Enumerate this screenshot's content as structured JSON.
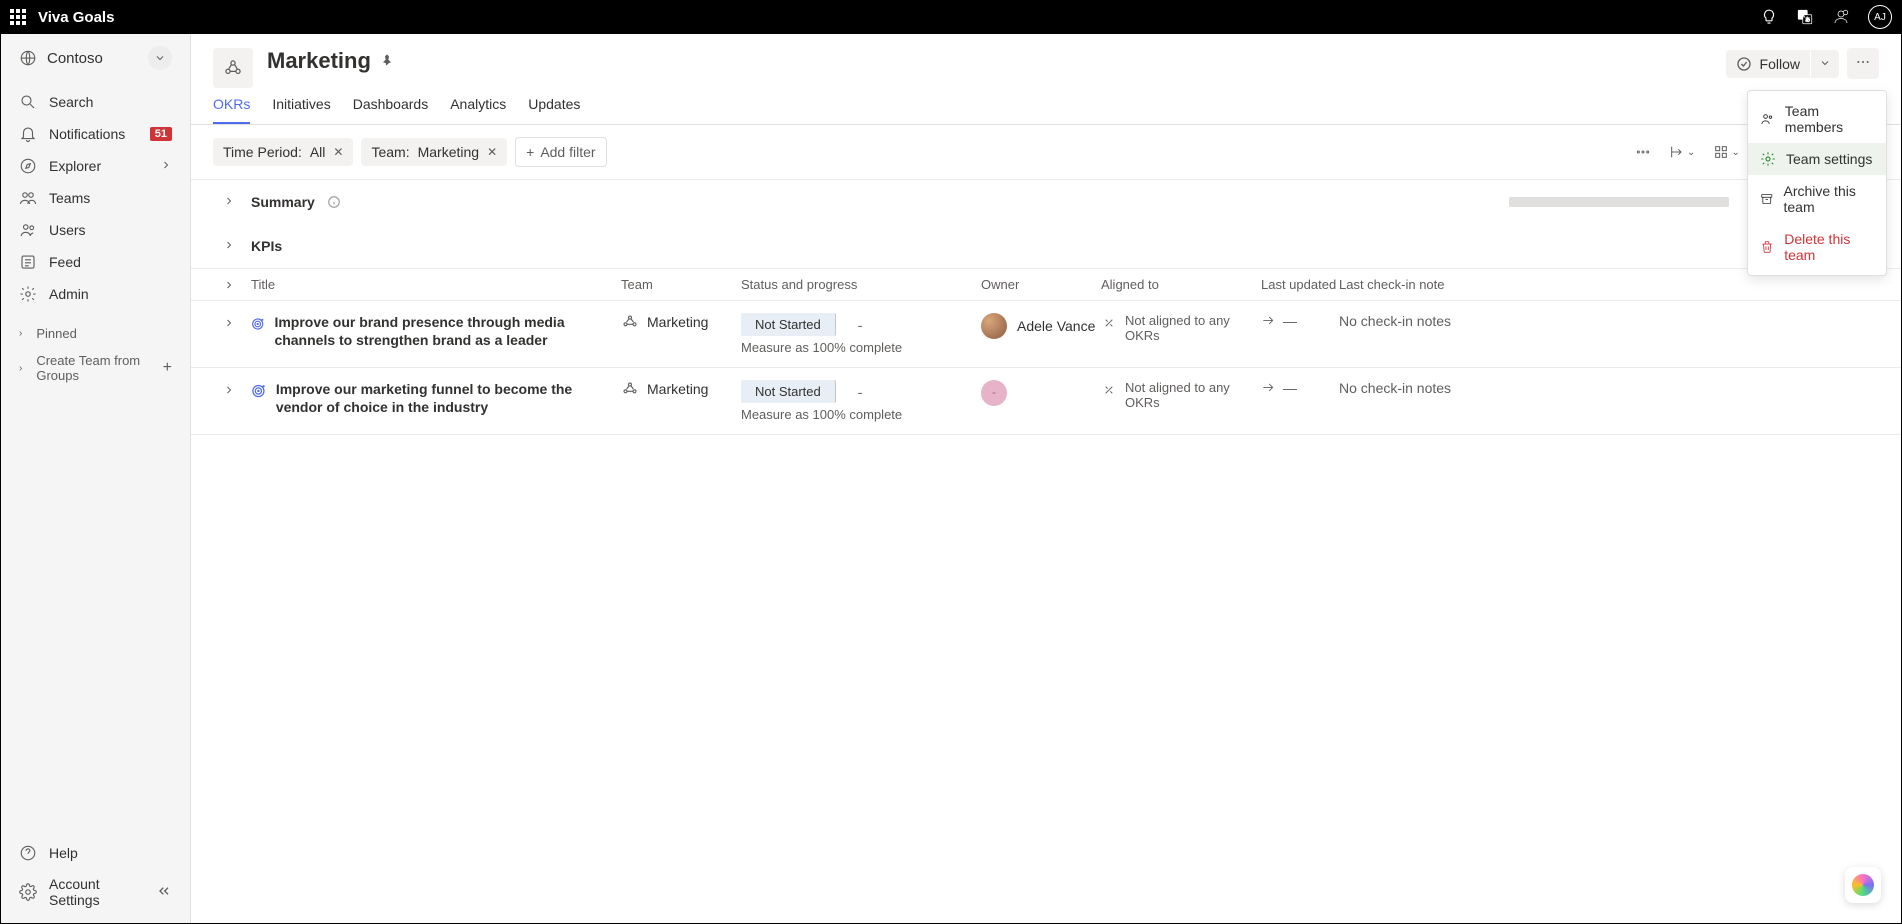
{
  "topbar": {
    "app_name": "Viva Goals",
    "avatar_initials": "AJ"
  },
  "sidebar": {
    "org_name": "Contoso",
    "nav": [
      {
        "label": "Search"
      },
      {
        "label": "Notifications",
        "badge": "51"
      },
      {
        "label": "Explorer",
        "chevron": true
      },
      {
        "label": "Teams"
      },
      {
        "label": "Users"
      },
      {
        "label": "Feed"
      },
      {
        "label": "Admin"
      }
    ],
    "pinned_label": "Pinned",
    "create_team_label": "Create Team from Groups",
    "help_label": "Help",
    "account_label": "Account Settings"
  },
  "header": {
    "title": "Marketing",
    "tabs": [
      "OKRs",
      "Initiatives",
      "Dashboards",
      "Analytics",
      "Updates"
    ],
    "active_tab": 0,
    "follow_label": "Follow"
  },
  "filters": {
    "time_label": "Time Period:",
    "time_value": "All",
    "team_label": "Team:",
    "team_value": "Marketing",
    "add_filter_label": "Add filter"
  },
  "sections": {
    "summary": "Summary",
    "kpis": "KPIs"
  },
  "table": {
    "cols": {
      "title": "Title",
      "team": "Team",
      "status": "Status and progress",
      "owner": "Owner",
      "aligned": "Aligned to",
      "updated": "Last updated",
      "notes": "Last check-in note"
    },
    "rows": [
      {
        "title": "Improve our brand presence through media channels to strengthen brand as a leader",
        "team": "Marketing",
        "status": "Not Started",
        "measure": "Measure as 100% complete",
        "progress": "-",
        "owner": "Adele Vance",
        "owner_initials": "AV",
        "owner_has_photo": true,
        "aligned": "Not aligned to any OKRs",
        "updated_dash": "—",
        "notes": "No check-in notes"
      },
      {
        "title": "Improve our marketing funnel to become the vendor of choice in the industry",
        "team": "Marketing",
        "status": "Not Started",
        "measure": "Measure as 100% complete",
        "progress": "-",
        "owner": "",
        "owner_initials": "-",
        "owner_has_photo": false,
        "aligned": "Not aligned to any OKRs",
        "updated_dash": "—",
        "notes": "No check-in notes"
      }
    ]
  },
  "menu": {
    "members": "Team members",
    "settings": "Team settings",
    "archive": "Archive this team",
    "delete": "Delete this team"
  }
}
